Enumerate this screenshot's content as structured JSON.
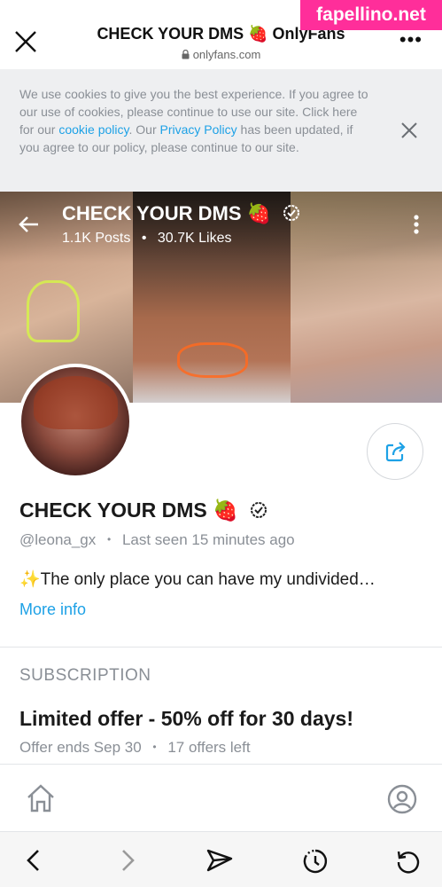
{
  "browser": {
    "title": "CHECK YOUR DMS 🍓 OnlyFans",
    "url": "onlyfans.com",
    "watermark": "fapellino.net"
  },
  "cookie_banner": {
    "text_1": "We use cookies to give you the best experience. If you agree to our use of cookies, please continue to use our site. Click here for our ",
    "link_cookie": "cookie policy",
    "text_2": ". Our ",
    "link_privacy": "Privacy Policy",
    "text_3": " has been updated, if you agree to our policy, please continue to our site."
  },
  "cover": {
    "name": "CHECK YOUR DMS 🍓",
    "posts": "1.1K Posts",
    "dot": "•",
    "likes": "30.7K Likes"
  },
  "profile": {
    "name": "CHECK YOUR DMS 🍓",
    "handle": "@leona_gx",
    "dot": "•",
    "last_seen": "Last seen 15 minutes ago",
    "bio": "✨The only place you can have my undivided…",
    "more_info": "More info"
  },
  "subscription": {
    "heading": "SUBSCRIPTION",
    "offer": "Limited offer - 50% off for 30 days!",
    "ends": "Offer ends Sep 30",
    "dot": "•",
    "left": "17 offers left"
  },
  "colors": {
    "accent": "#1da1e6",
    "muted": "#8a8f96",
    "banner_bg": "#eeeff1",
    "watermark": "#ff2e9a"
  },
  "icons": [
    "close-icon",
    "lock-icon",
    "more-icon",
    "back-icon",
    "verified-icon",
    "kebab-icon",
    "share-icon",
    "home-icon",
    "user-icon",
    "nav-back-icon",
    "nav-forward-icon",
    "send-icon",
    "timer-icon",
    "reload-icon"
  ]
}
